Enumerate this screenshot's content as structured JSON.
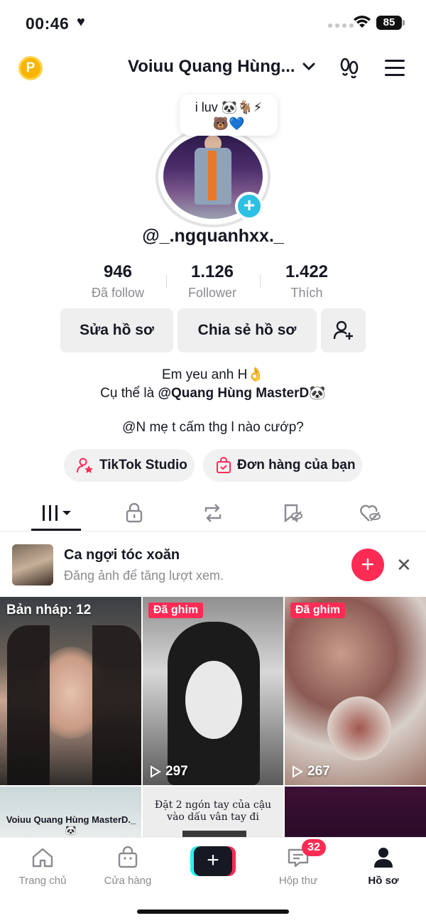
{
  "status_bar": {
    "time": "00:46",
    "battery": "85"
  },
  "header": {
    "coin_label": "P",
    "account_name": "Voiuu Quang Hùng..."
  },
  "profile": {
    "note_line1": "i luv 🐼🐐⚡",
    "note_line2": "🐻💙",
    "username": "@_.ngquanhxx._",
    "stats": [
      {
        "value": "946",
        "label": "Đã follow"
      },
      {
        "value": "1.126",
        "label": "Follower"
      },
      {
        "value": "1.422",
        "label": "Thích"
      }
    ],
    "edit_button": "Sửa hồ sơ",
    "share_button": "Chia sẻ hồ sơ",
    "bio_line1": "Em yeu anh H👌",
    "bio_line2_prefix": "Cụ thể là ",
    "bio_line2_mention": "@Quang Hùng MasterD🐼",
    "bio_line3": "@N mẹ t cấm thg l nào cướp?",
    "studio_button": "TikTok Studio",
    "orders_button": "Đơn hàng của bạn"
  },
  "suggestion": {
    "title": "Ca ngợi tóc xoăn",
    "subtitle": "Đăng ảnh để tăng lượt xem."
  },
  "grid": {
    "draft_label": "Bản nháp: 12",
    "pinned_label": "Đã ghim",
    "cell2_views": "297",
    "cell3_views": "267",
    "cell4_text": "Voiuu Quang Hùng MasterD._🐼",
    "cell5_text": "Đặt 2 ngón tay của cậu vào dấu vân tay đi"
  },
  "bottom_nav": {
    "home": "Trang chủ",
    "shop": "Cửa hàng",
    "inbox": "Hộp thư",
    "inbox_badge": "32",
    "profile": "Hồ sơ"
  },
  "colors": {
    "accent": "#fe2c55",
    "cyan": "#25f4ee",
    "text": "#161823",
    "muted": "#8a8b91"
  }
}
